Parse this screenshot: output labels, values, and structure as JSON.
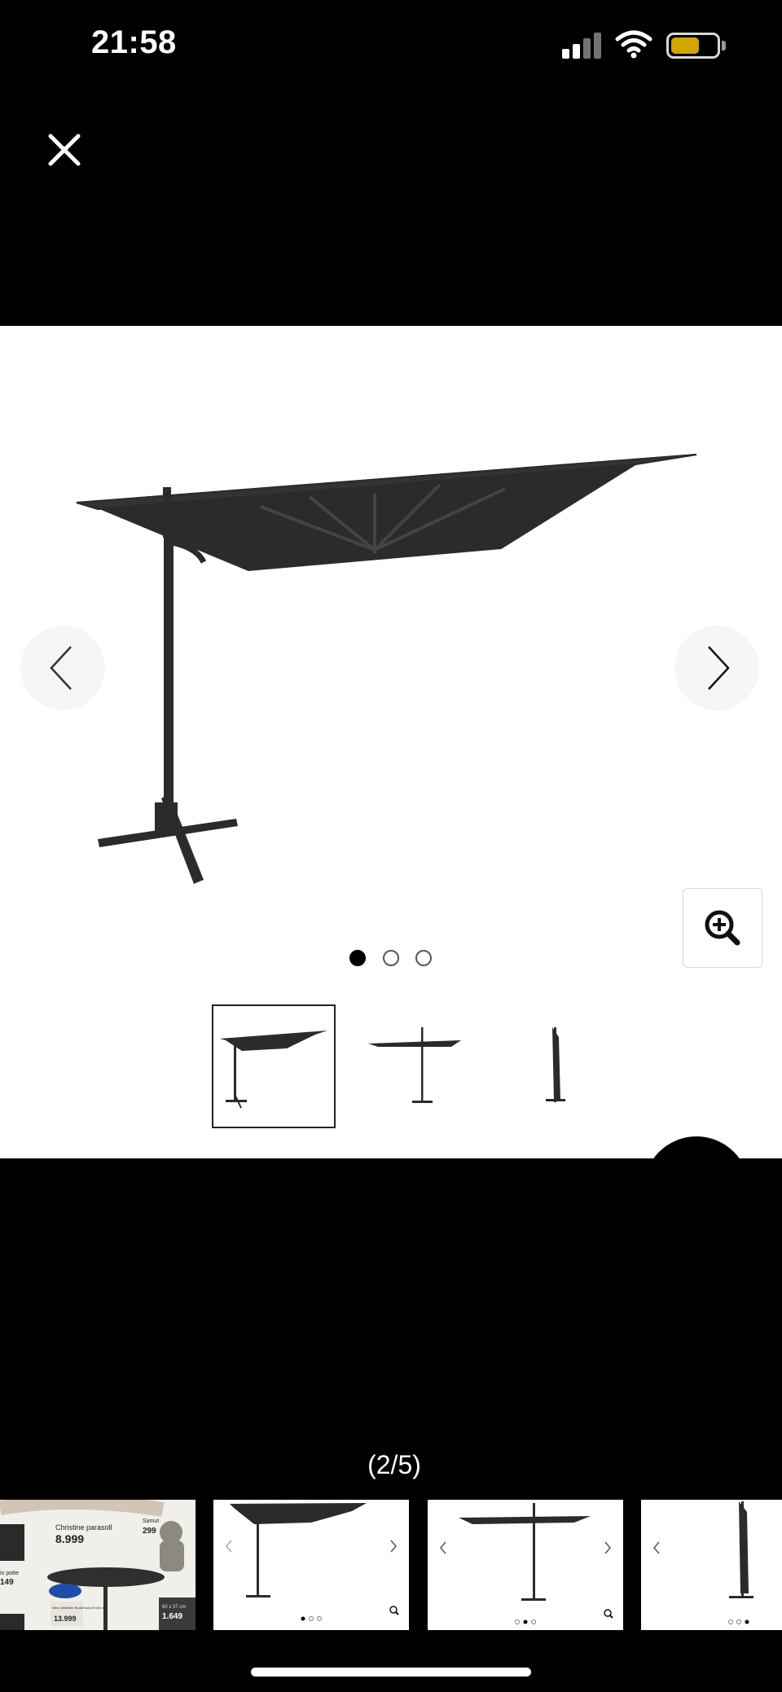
{
  "status_bar": {
    "time": "21:58"
  },
  "viewer": {
    "close_icon": "close-icon",
    "counter": "(2/5)",
    "zoom_icon": "zoom-in-icon",
    "prev_icon": "chevron-left-icon",
    "next_icon": "chevron-right-icon",
    "dots": [
      {
        "active": true
      },
      {
        "active": false
      },
      {
        "active": false
      }
    ],
    "thumbnails": [
      {
        "name": "parasol-side-view",
        "active": true
      },
      {
        "name": "parasol-front-view",
        "active": false
      },
      {
        "name": "parasol-folded-view",
        "active": false
      }
    ]
  },
  "filmstrip": {
    "items": [
      {
        "name": "catalog-page",
        "labels": {
          "product": "Christine parasoll",
          "price_main": "8.999",
          "buddha_label": "Samut",
          "buddha_price": "299",
          "left_label": "in potte",
          "left_price": "149",
          "table_label": "Kleiv Ortheden Rundt bord Ø 100 cm",
          "table_price": "13.999",
          "planter_label": "60 x 37 cm",
          "planter_price": "1.649"
        }
      },
      {
        "name": "image-2-preview"
      },
      {
        "name": "image-3-preview"
      },
      {
        "name": "image-4-preview"
      }
    ]
  },
  "colors": {
    "background": "#000000",
    "panel": "#ffffff",
    "parasol": "#2b2b2b",
    "battery": "#f5c400"
  }
}
